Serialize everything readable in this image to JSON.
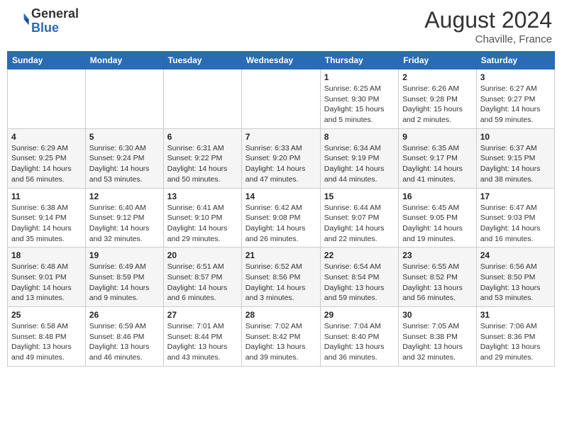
{
  "header": {
    "logo_general": "General",
    "logo_blue": "Blue",
    "month_year": "August 2024",
    "location": "Chaville, France"
  },
  "weekdays": [
    "Sunday",
    "Monday",
    "Tuesday",
    "Wednesday",
    "Thursday",
    "Friday",
    "Saturday"
  ],
  "weeks": [
    [
      {
        "day": "",
        "sunrise": "",
        "sunset": "",
        "daylight": ""
      },
      {
        "day": "",
        "sunrise": "",
        "sunset": "",
        "daylight": ""
      },
      {
        "day": "",
        "sunrise": "",
        "sunset": "",
        "daylight": ""
      },
      {
        "day": "",
        "sunrise": "",
        "sunset": "",
        "daylight": ""
      },
      {
        "day": "1",
        "sunrise": "Sunrise: 6:25 AM",
        "sunset": "Sunset: 9:30 PM",
        "daylight": "Daylight: 15 hours and 5 minutes."
      },
      {
        "day": "2",
        "sunrise": "Sunrise: 6:26 AM",
        "sunset": "Sunset: 9:28 PM",
        "daylight": "Daylight: 15 hours and 2 minutes."
      },
      {
        "day": "3",
        "sunrise": "Sunrise: 6:27 AM",
        "sunset": "Sunset: 9:27 PM",
        "daylight": "Daylight: 14 hours and 59 minutes."
      }
    ],
    [
      {
        "day": "4",
        "sunrise": "Sunrise: 6:29 AM",
        "sunset": "Sunset: 9:25 PM",
        "daylight": "Daylight: 14 hours and 56 minutes."
      },
      {
        "day": "5",
        "sunrise": "Sunrise: 6:30 AM",
        "sunset": "Sunset: 9:24 PM",
        "daylight": "Daylight: 14 hours and 53 minutes."
      },
      {
        "day": "6",
        "sunrise": "Sunrise: 6:31 AM",
        "sunset": "Sunset: 9:22 PM",
        "daylight": "Daylight: 14 hours and 50 minutes."
      },
      {
        "day": "7",
        "sunrise": "Sunrise: 6:33 AM",
        "sunset": "Sunset: 9:20 PM",
        "daylight": "Daylight: 14 hours and 47 minutes."
      },
      {
        "day": "8",
        "sunrise": "Sunrise: 6:34 AM",
        "sunset": "Sunset: 9:19 PM",
        "daylight": "Daylight: 14 hours and 44 minutes."
      },
      {
        "day": "9",
        "sunrise": "Sunrise: 6:35 AM",
        "sunset": "Sunset: 9:17 PM",
        "daylight": "Daylight: 14 hours and 41 minutes."
      },
      {
        "day": "10",
        "sunrise": "Sunrise: 6:37 AM",
        "sunset": "Sunset: 9:15 PM",
        "daylight": "Daylight: 14 hours and 38 minutes."
      }
    ],
    [
      {
        "day": "11",
        "sunrise": "Sunrise: 6:38 AM",
        "sunset": "Sunset: 9:14 PM",
        "daylight": "Daylight: 14 hours and 35 minutes."
      },
      {
        "day": "12",
        "sunrise": "Sunrise: 6:40 AM",
        "sunset": "Sunset: 9:12 PM",
        "daylight": "Daylight: 14 hours and 32 minutes."
      },
      {
        "day": "13",
        "sunrise": "Sunrise: 6:41 AM",
        "sunset": "Sunset: 9:10 PM",
        "daylight": "Daylight: 14 hours and 29 minutes."
      },
      {
        "day": "14",
        "sunrise": "Sunrise: 6:42 AM",
        "sunset": "Sunset: 9:08 PM",
        "daylight": "Daylight: 14 hours and 26 minutes."
      },
      {
        "day": "15",
        "sunrise": "Sunrise: 6:44 AM",
        "sunset": "Sunset: 9:07 PM",
        "daylight": "Daylight: 14 hours and 22 minutes."
      },
      {
        "day": "16",
        "sunrise": "Sunrise: 6:45 AM",
        "sunset": "Sunset: 9:05 PM",
        "daylight": "Daylight: 14 hours and 19 minutes."
      },
      {
        "day": "17",
        "sunrise": "Sunrise: 6:47 AM",
        "sunset": "Sunset: 9:03 PM",
        "daylight": "Daylight: 14 hours and 16 minutes."
      }
    ],
    [
      {
        "day": "18",
        "sunrise": "Sunrise: 6:48 AM",
        "sunset": "Sunset: 9:01 PM",
        "daylight": "Daylight: 14 hours and 13 minutes."
      },
      {
        "day": "19",
        "sunrise": "Sunrise: 6:49 AM",
        "sunset": "Sunset: 8:59 PM",
        "daylight": "Daylight: 14 hours and 9 minutes."
      },
      {
        "day": "20",
        "sunrise": "Sunrise: 6:51 AM",
        "sunset": "Sunset: 8:57 PM",
        "daylight": "Daylight: 14 hours and 6 minutes."
      },
      {
        "day": "21",
        "sunrise": "Sunrise: 6:52 AM",
        "sunset": "Sunset: 8:56 PM",
        "daylight": "Daylight: 14 hours and 3 minutes."
      },
      {
        "day": "22",
        "sunrise": "Sunrise: 6:54 AM",
        "sunset": "Sunset: 8:54 PM",
        "daylight": "Daylight: 13 hours and 59 minutes."
      },
      {
        "day": "23",
        "sunrise": "Sunrise: 6:55 AM",
        "sunset": "Sunset: 8:52 PM",
        "daylight": "Daylight: 13 hours and 56 minutes."
      },
      {
        "day": "24",
        "sunrise": "Sunrise: 6:56 AM",
        "sunset": "Sunset: 8:50 PM",
        "daylight": "Daylight: 13 hours and 53 minutes."
      }
    ],
    [
      {
        "day": "25",
        "sunrise": "Sunrise: 6:58 AM",
        "sunset": "Sunset: 8:48 PM",
        "daylight": "Daylight: 13 hours and 49 minutes."
      },
      {
        "day": "26",
        "sunrise": "Sunrise: 6:59 AM",
        "sunset": "Sunset: 8:46 PM",
        "daylight": "Daylight: 13 hours and 46 minutes."
      },
      {
        "day": "27",
        "sunrise": "Sunrise: 7:01 AM",
        "sunset": "Sunset: 8:44 PM",
        "daylight": "Daylight: 13 hours and 43 minutes."
      },
      {
        "day": "28",
        "sunrise": "Sunrise: 7:02 AM",
        "sunset": "Sunset: 8:42 PM",
        "daylight": "Daylight: 13 hours and 39 minutes."
      },
      {
        "day": "29",
        "sunrise": "Sunrise: 7:04 AM",
        "sunset": "Sunset: 8:40 PM",
        "daylight": "Daylight: 13 hours and 36 minutes."
      },
      {
        "day": "30",
        "sunrise": "Sunrise: 7:05 AM",
        "sunset": "Sunset: 8:38 PM",
        "daylight": "Daylight: 13 hours and 32 minutes."
      },
      {
        "day": "31",
        "sunrise": "Sunrise: 7:06 AM",
        "sunset": "Sunset: 8:36 PM",
        "daylight": "Daylight: 13 hours and 29 minutes."
      }
    ]
  ]
}
